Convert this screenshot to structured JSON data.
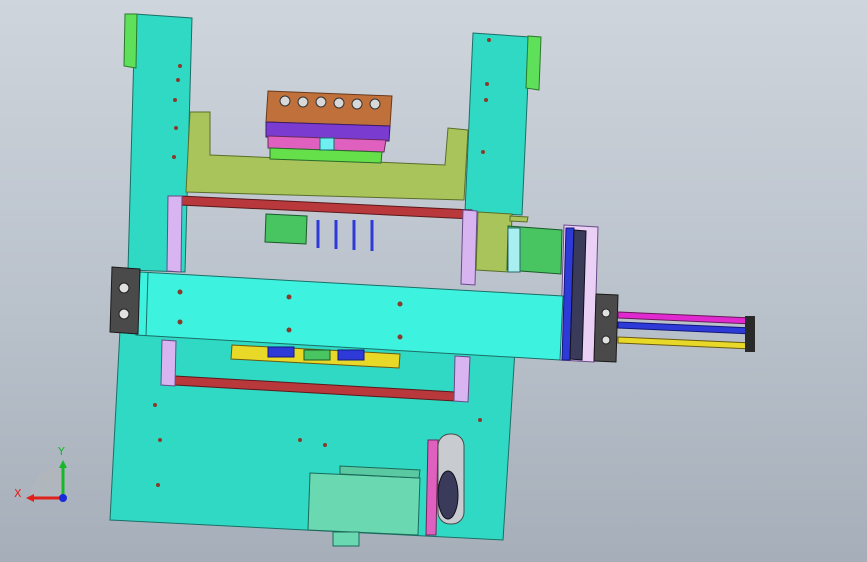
{
  "viewport": {
    "background_top": "#cfd5dc",
    "background_bottom": "#a6aeb9"
  },
  "triad": {
    "x_label": "X",
    "y_label": "Y",
    "x_color": "#e0201a",
    "y_color": "#16b82a",
    "z_color": "#1a2ad8"
  },
  "colors": {
    "frame_teal": "#2fd9c4",
    "beam_cyan": "#3ef2e0",
    "olive_plate": "#a8c45a",
    "rail_red": "#b8383c",
    "brass_block": "#c0703a",
    "purple_block": "#7a3cd0",
    "green_motor": "#48c460",
    "bracket_lilac": "#d8b4f0",
    "dark_grey": "#4a4a4a",
    "yellow_bar": "#e8d828",
    "magenta_rod": "#e02ad0",
    "blue_rod": "#2e3ad8",
    "mint_motor": "#6ad8b0"
  }
}
